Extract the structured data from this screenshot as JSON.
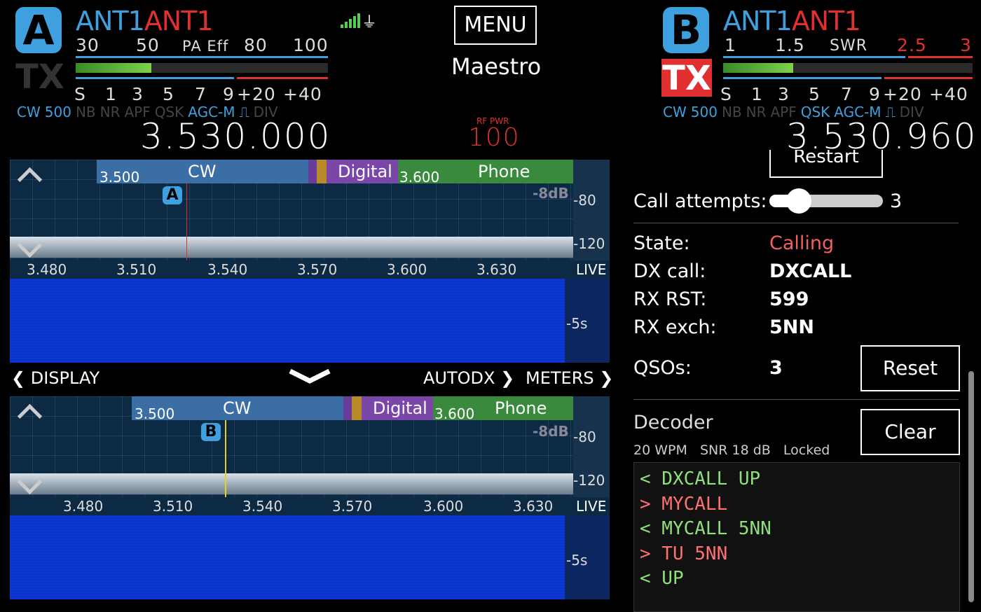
{
  "vfoA": {
    "badge": "A",
    "ant_rx": "ANT1",
    "ant_tx": "ANT1",
    "tx_label": "TX",
    "meter_top": [
      "30",
      "50",
      "PA Eff",
      "80",
      "100"
    ],
    "meter_bottom": [
      "S",
      "1",
      "3",
      "5",
      "7",
      "9",
      "+20",
      "+40"
    ],
    "meter_level": 0.3,
    "status": [
      {
        "text": "CW",
        "on": true
      },
      {
        "text": "500",
        "on": true
      },
      {
        "text": "NB",
        "on": false
      },
      {
        "text": "NR",
        "on": false
      },
      {
        "text": "APF",
        "on": false
      },
      {
        "text": "QSK",
        "on": false
      },
      {
        "text": "AGC-M",
        "on": true
      },
      {
        "text": "⎍",
        "on": true
      },
      {
        "text": "DIV",
        "on": false
      }
    ],
    "freq": "3.530.000"
  },
  "vfoB": {
    "badge": "B",
    "ant_rx": "ANT1",
    "ant_tx": "ANT1",
    "tx_label": "TX",
    "meter_top": [
      "1",
      "1.5",
      "SWR",
      "2.5",
      "3"
    ],
    "meter_bottom": [
      "S",
      "1",
      "3",
      "5",
      "7",
      "9",
      "+20",
      "+40"
    ],
    "meter_level": 0.28,
    "status": [
      {
        "text": "CW",
        "on": true
      },
      {
        "text": "500",
        "on": true
      },
      {
        "text": "NB",
        "on": false
      },
      {
        "text": "NR",
        "on": false
      },
      {
        "text": "APF",
        "on": false
      },
      {
        "text": "QSK",
        "on": true
      },
      {
        "text": "AGC-M",
        "on": true
      },
      {
        "text": "⎍",
        "on": true
      },
      {
        "text": "DIV",
        "on": false
      }
    ],
    "freq": "3.530.960"
  },
  "center": {
    "menu": "MENU",
    "title": "Maestro",
    "rf_pwr_label": "RF PWR",
    "rf_pwr": "100"
  },
  "panA": {
    "bands": {
      "cw": "CW",
      "digital": "Digital",
      "phone": "Phone",
      "start1": "3.500",
      "start2": "3.600"
    },
    "db": "-8dB",
    "scale": [
      "-80",
      "-120"
    ],
    "axis": [
      "3.480",
      "3.510",
      "3.540",
      "3.570",
      "3.600",
      "3.630"
    ],
    "live": "LIVE",
    "wf_time": "-5s",
    "marker": "A"
  },
  "panB": {
    "bands": {
      "cw": "CW",
      "digital": "Digital",
      "phone": "Phone",
      "start1": "3.500",
      "start2": "3.600"
    },
    "db": "-8dB",
    "scale": [
      "-80",
      "-120"
    ],
    "axis": [
      "3.480",
      "3.510",
      "3.540",
      "3.570",
      "3.600",
      "3.630"
    ],
    "live": "LIVE",
    "wf_time": "-5s",
    "marker": "B"
  },
  "nav": {
    "display": "DISPLAY",
    "autodx": "AUTODX",
    "meters": "METERS"
  },
  "right": {
    "restart": "Restart",
    "call_attempts_label": "Call attempts:",
    "call_attempts": "3",
    "state_label": "State:",
    "state": "Calling",
    "dxcall_label": "DX call:",
    "dxcall": "DXCALL",
    "rxrst_label": "RX RST:",
    "rxrst": "599",
    "rxexch_label": "RX exch:",
    "rxexch": "5NN",
    "qsos_label": "QSOs:",
    "qsos": "3",
    "reset": "Reset",
    "decoder_title": "Decoder",
    "decoder_stats": "20 WPM   SNR 18 dB   Locked",
    "clear": "Clear",
    "lines": [
      {
        "dir": "<",
        "text": "DXCALL UP"
      },
      {
        "dir": ">",
        "text": "MYCALL"
      },
      {
        "dir": "<",
        "text": "MYCALL 5NN"
      },
      {
        "dir": ">",
        "text": "TU 5NN"
      },
      {
        "dir": "<",
        "text": "UP"
      }
    ]
  },
  "colors": {
    "accent": "#3fa0e0",
    "red": "#e03030",
    "rx_green": "#8fe07a",
    "tx_red": "#ff7070",
    "state": "#f06060"
  }
}
